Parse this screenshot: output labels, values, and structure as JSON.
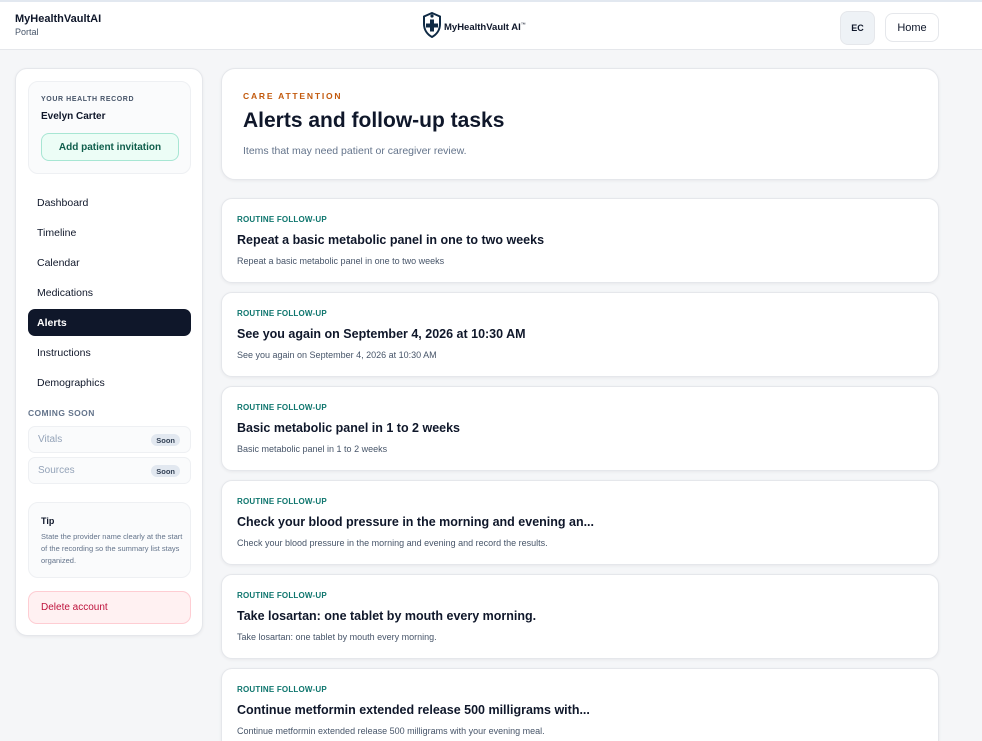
{
  "topbar": {
    "brand_name": "MyHealthVaultAI",
    "brand_sub": "Portal",
    "logo_text": "MyHealthVault AI",
    "logo_mark": "™",
    "avatar_initials": "EC",
    "home_label": "Home"
  },
  "sidebar": {
    "record_label": "YOUR HEALTH RECORD",
    "record_name": "Evelyn Carter",
    "invite_label": "Add patient invitation",
    "nav": [
      {
        "label": "Dashboard"
      },
      {
        "label": "Timeline"
      },
      {
        "label": "Calendar"
      },
      {
        "label": "Medications"
      },
      {
        "label": "Alerts"
      },
      {
        "label": "Instructions"
      },
      {
        "label": "Demographics"
      }
    ],
    "active_nav": "Alerts",
    "coming_soon_heading": "COMING SOON",
    "coming_soon": [
      {
        "label": "Vitals",
        "badge": "Soon"
      },
      {
        "label": "Sources",
        "badge": "Soon"
      }
    ],
    "tip_title": "Tip",
    "tip_text": "State the provider name clearly at the start of the recording so the summary list stays organized.",
    "delete_label": "Delete account"
  },
  "header": {
    "eyebrow": "CARE ATTENTION",
    "title": "Alerts and follow-up tasks",
    "subtitle": "Items that may need patient or caregiver review."
  },
  "alerts": [
    {
      "tag": "ROUTINE FOLLOW-UP",
      "title": "Repeat a basic metabolic panel in one to two weeks",
      "desc": "Repeat a basic metabolic panel in one to two weeks"
    },
    {
      "tag": "ROUTINE FOLLOW-UP",
      "title": "See you again on September 4, 2026 at 10:30 AM",
      "desc": "See you again on September 4, 2026 at 10:30 AM"
    },
    {
      "tag": "ROUTINE FOLLOW-UP",
      "title": "Basic metabolic panel in 1 to 2 weeks",
      "desc": "Basic metabolic panel in 1 to 2 weeks"
    },
    {
      "tag": "ROUTINE FOLLOW-UP",
      "title": "Check your blood pressure in the morning and evening an...",
      "desc": "Check your blood pressure in the morning and evening and record the results."
    },
    {
      "tag": "ROUTINE FOLLOW-UP",
      "title": "Take losartan: one tablet by mouth every morning.",
      "desc": "Take losartan: one tablet by mouth every morning."
    },
    {
      "tag": "ROUTINE FOLLOW-UP",
      "title": "Continue metformin extended release 500 milligrams with...",
      "desc": "Continue metformin extended release 500 milligrams with your evening meal."
    }
  ],
  "colors": {
    "accent_dark": "#0f172a",
    "eyebrow_orange": "#c2590c",
    "tag_teal": "#0f766e",
    "danger": "#be123c"
  },
  "icons": {
    "logo": "shield-cross-icon"
  }
}
